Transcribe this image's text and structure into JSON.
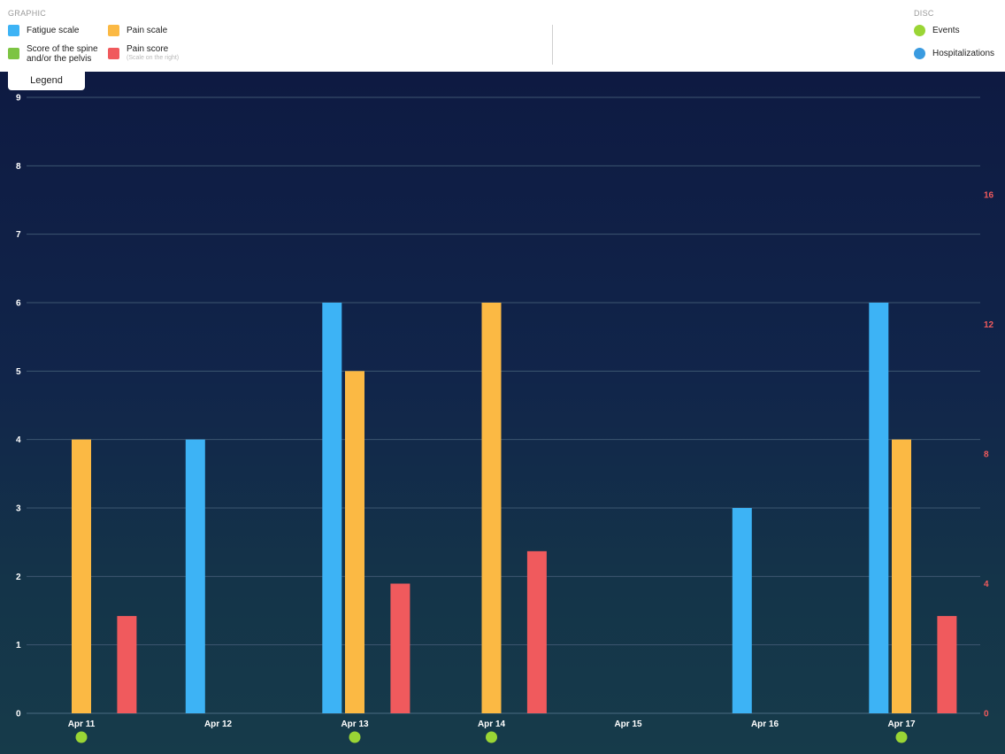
{
  "legend": {
    "graphic_title": "GRAPHIC",
    "disc_title": "DISC",
    "tab_label": "Legend",
    "items": [
      {
        "label": "Fatigue scale",
        "color": "#3db3f5"
      },
      {
        "label": "Pain scale",
        "color": "#fbb944"
      },
      {
        "label": "Score of the spine and/or the pelvis",
        "color": "#7dc443"
      },
      {
        "label": "Pain score",
        "sublabel": "(Scale on the right)",
        "color": "#f05a5d"
      }
    ],
    "disc_items": [
      {
        "label": "Events",
        "color": "#9ad535"
      },
      {
        "label": "Hospitalizations",
        "color": "#3a9be0"
      }
    ]
  },
  "chart_data": {
    "type": "bar",
    "categories": [
      "Apr 11",
      "Apr 12",
      "Apr 13",
      "Apr 14",
      "Apr 15",
      "Apr 16",
      "Apr 17"
    ],
    "series": [
      {
        "name": "Fatigue scale",
        "axis": "left",
        "color": "#3db3f5",
        "values": [
          null,
          4,
          6,
          null,
          null,
          3,
          6
        ]
      },
      {
        "name": "Pain scale",
        "axis": "left",
        "color": "#fbb944",
        "values": [
          4,
          null,
          5,
          6,
          null,
          null,
          4
        ]
      },
      {
        "name": "Score of the spine and/or the pelvis",
        "axis": "left",
        "color": "#7dc443",
        "values": [
          null,
          null,
          null,
          null,
          null,
          null,
          null
        ]
      },
      {
        "name": "Pain score",
        "axis": "right",
        "color": "#f05a5d",
        "values": [
          3,
          null,
          4,
          5,
          null,
          null,
          3
        ]
      }
    ],
    "events": [
      true,
      false,
      true,
      true,
      false,
      false,
      true
    ],
    "event_color": "#9ad535",
    "y_left": {
      "ticks": [
        "0",
        "1",
        "2",
        "3",
        "4",
        "5",
        "6",
        "7",
        "8",
        "9"
      ],
      "range": [
        0,
        9
      ]
    },
    "y_right": {
      "ticks": [
        "0",
        "4",
        "8",
        "12",
        "16"
      ],
      "range": [
        0,
        19
      ],
      "color": "#f05a5d"
    },
    "grid": true
  }
}
